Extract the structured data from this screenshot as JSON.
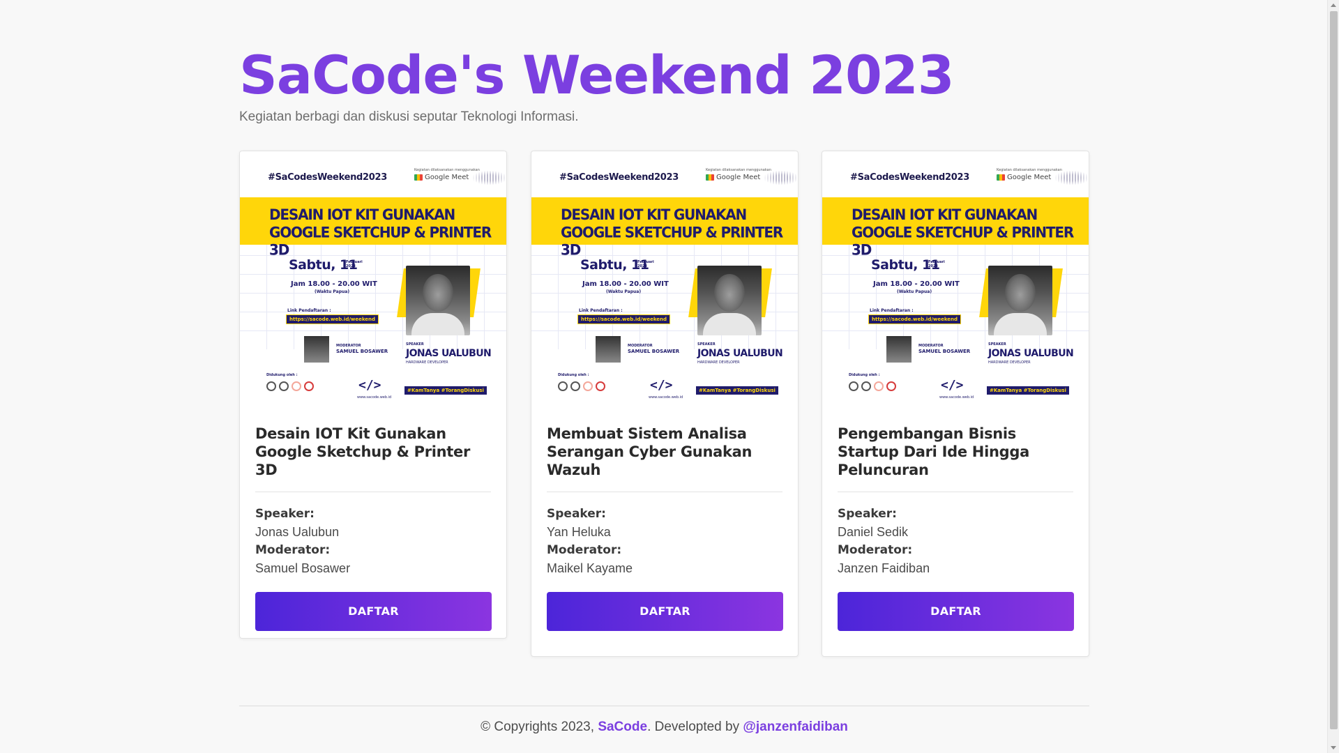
{
  "header": {
    "title": "SaCode's Weekend 2023",
    "subtitle": "Kegiatan berbagi dan diskusi seputar Teknologi Informasi."
  },
  "poster": {
    "hashtag": "#SaCodesWeekend2023",
    "platform_note": "Kegiatan dilaksanakan menggunakan",
    "platform": "Google Meet",
    "banner_line1": "DESAIN IOT KIT GUNAKAN",
    "banner_line2": "GOOGLE  SKETCHUP & PRINTER 3D",
    "date": "Sabtu, 11",
    "month": "Februari",
    "year": "2023",
    "time": "Jam 18.00 - 20.00 WIT",
    "timezone": "(Waktu Papua)",
    "link_label": "Link Pendaftaran :",
    "link": "https://sacode.web.id/weekend",
    "moderator_label": "MODERATOR",
    "moderator_name": "SAMUEL BOSAWER",
    "speaker_label": "SPEAKER",
    "speaker_name": "JONAS UALUBUN",
    "speaker_role": "HARDWARE DEVELOPER",
    "supported_by": "Didukung oleh :",
    "code_logo": "</>",
    "site": "www.sacode.web.id",
    "tags": "#KamTanya #TorangDiskusi"
  },
  "cards": [
    {
      "title": "Desain IOT Kit Gunakan Google Sketchup & Printer 3D",
      "speaker_label": "Speaker:",
      "speaker": "Jonas Ualubun",
      "moderator_label": "Moderator:",
      "moderator": "Samuel Bosawer",
      "button": "DAFTAR"
    },
    {
      "title": "Membuat Sistem Analisa Serangan Cyber Gunakan Wazuh",
      "speaker_label": "Speaker:",
      "speaker": "Yan Heluka",
      "moderator_label": "Moderator:",
      "moderator": "Maikel Kayame",
      "button": "DAFTAR"
    },
    {
      "title": "Pengembangan Bisnis Startup Dari Ide Hingga Peluncuran",
      "speaker_label": "Speaker:",
      "speaker": "Daniel Sedik",
      "moderator_label": "Moderator:",
      "moderator": "Janzen Faidiban",
      "button": "DAFTAR"
    }
  ],
  "footer": {
    "prefix": "© Copyrights 2023,",
    "brand": "SaCode",
    "middle": ". Developted by",
    "author": "@janzenfaidiban"
  },
  "colors": {
    "accent": "#7b3fe0",
    "button_start": "#4c25d9",
    "button_end": "#8b35e0",
    "poster_yellow": "#ffd60a",
    "poster_navy": "#1f1b6b"
  }
}
